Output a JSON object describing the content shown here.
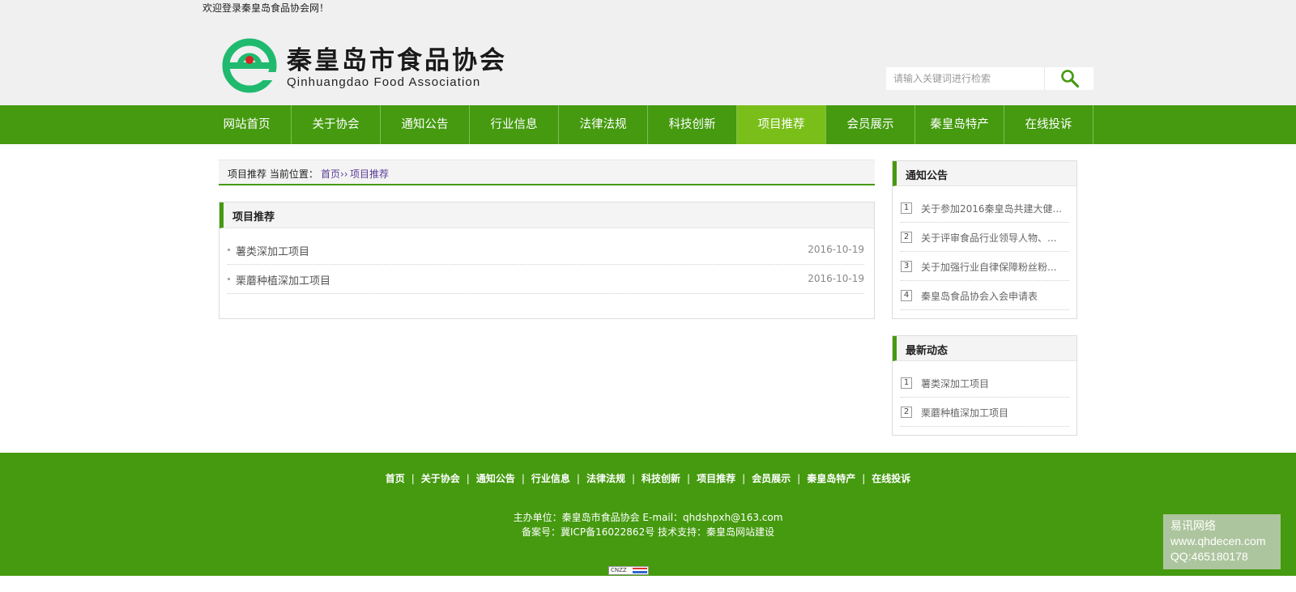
{
  "header": {
    "welcome": "欢迎登录秦皇岛食品协会网！",
    "logo_cn": "秦皇岛市食品协会",
    "logo_en": "Qinhuangdao Food Association",
    "search_placeholder": "请输入关键词进行检索",
    "search_icon": "search-icon"
  },
  "nav": {
    "items": [
      "网站首页",
      "关于协会",
      "通知公告",
      "行业信息",
      "法律法规",
      "科技创新",
      "项目推荐",
      "会员展示",
      "秦皇岛特产",
      "在线投诉"
    ],
    "active": "项目推荐"
  },
  "breadcrumb": {
    "label": "项目推荐 当前位置：",
    "home": "首页››",
    "current": "项目推荐"
  },
  "main": {
    "title": "项目推荐",
    "items": [
      {
        "title": "薯类深加工项目",
        "date": "2016-10-19"
      },
      {
        "title": "栗蘑种植深加工项目",
        "date": "2016-10-19"
      }
    ]
  },
  "sidebar": {
    "notices": {
      "title": "通知公告",
      "items": [
        {
          "num": "1",
          "text": "关于参加2016秦皇岛共建大健..."
        },
        {
          "num": "2",
          "text": "关于评审食品行业领导人物、..."
        },
        {
          "num": "3",
          "text": "关于加强行业自律保障粉丝粉..."
        },
        {
          "num": "4",
          "text": "秦皇岛食品协会入会申请表"
        }
      ]
    },
    "latest": {
      "title": "最新动态",
      "items": [
        {
          "num": "1",
          "text": "薯类深加工项目"
        },
        {
          "num": "2",
          "text": "栗蘑种植深加工项目"
        }
      ]
    }
  },
  "footer": {
    "links": [
      "首页",
      "关于协会",
      "通知公告",
      "行业信息",
      "法律法规",
      "科技创新",
      "项目推荐",
      "会员展示",
      "秦皇岛特产",
      "在线投诉"
    ],
    "separator": "|",
    "line1": "主办单位：秦皇岛市食品协会 E-mail：qhdshpxh@163.com",
    "line2": "备案号：冀ICP备16022862号   技术支持：秦皇岛网站建设",
    "cnzz": "CNZZ"
  },
  "watermark": {
    "line1": "易讯网络",
    "line2": "www.qhdecen.com",
    "line3": "QQ:465180178"
  },
  "colors": {
    "brand_green": "#459a0f",
    "nav_active": "#7abf19",
    "logo_green": "#1fba6e",
    "logo_red": "#d82323"
  }
}
